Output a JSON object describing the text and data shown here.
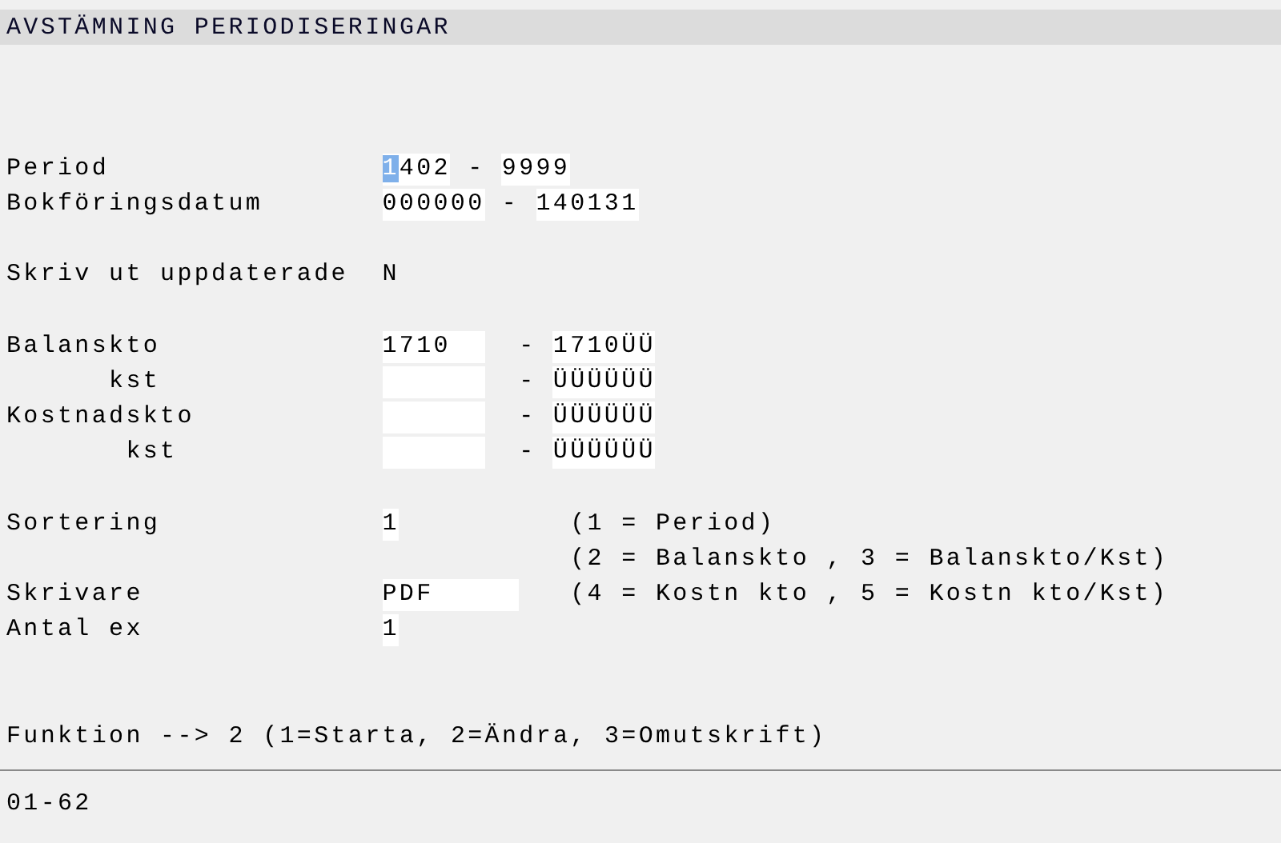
{
  "title": "AVSTÄMNING PERIODISERINGAR",
  "lines": [
    {
      "kind": "blank"
    },
    {
      "kind": "blank"
    },
    {
      "kind": "blank"
    },
    {
      "kind": "range",
      "label": "Period",
      "from": {
        "value": "1402",
        "cursor": true
      },
      "separator": "-",
      "to": {
        "value": "9999"
      }
    },
    {
      "kind": "range",
      "label": "Bokföringsdatum",
      "from": {
        "value": "000000"
      },
      "separator": "-",
      "to": {
        "value": "140131"
      }
    },
    {
      "kind": "blank"
    },
    {
      "kind": "flag",
      "label": "Skriv ut uppdaterade",
      "value": "N"
    },
    {
      "kind": "blank"
    },
    {
      "kind": "account",
      "label": "Balanskto",
      "from": {
        "value": "1710"
      },
      "separator": "-",
      "to": {
        "value": "1710ÜÜ"
      }
    },
    {
      "kind": "account",
      "label": "      kst",
      "separator": "-",
      "to": {
        "value": "ÜÜÜÜÜÜ"
      }
    },
    {
      "kind": "account",
      "label": "Kostnadskto",
      "separator": "-",
      "to": {
        "value": "ÜÜÜÜÜÜ"
      }
    },
    {
      "kind": "account",
      "label": "       kst",
      "separator": "-",
      "to": {
        "value": "ÜÜÜÜÜÜ"
      }
    },
    {
      "kind": "blank"
    },
    {
      "kind": "number",
      "label": "Sortering",
      "value": "1",
      "hint": "(1 = Period)"
    },
    {
      "kind": "hint",
      "hint": "(2 = Balanskto , 3 = Balanskto/Kst)"
    },
    {
      "kind": "printer",
      "label": "Skrivare",
      "value": "PDF",
      "hint": "(4 = Kostn kto , 5 = Kostn kto/Kst)"
    },
    {
      "kind": "number",
      "label": "Antal ex",
      "value": "1"
    },
    {
      "kind": "blank"
    },
    {
      "kind": "blank"
    }
  ],
  "prompt": "Funktion --> 2 (1=Starta, 2=Ändra, 3=Omutskrift)",
  "status": "01-62"
}
